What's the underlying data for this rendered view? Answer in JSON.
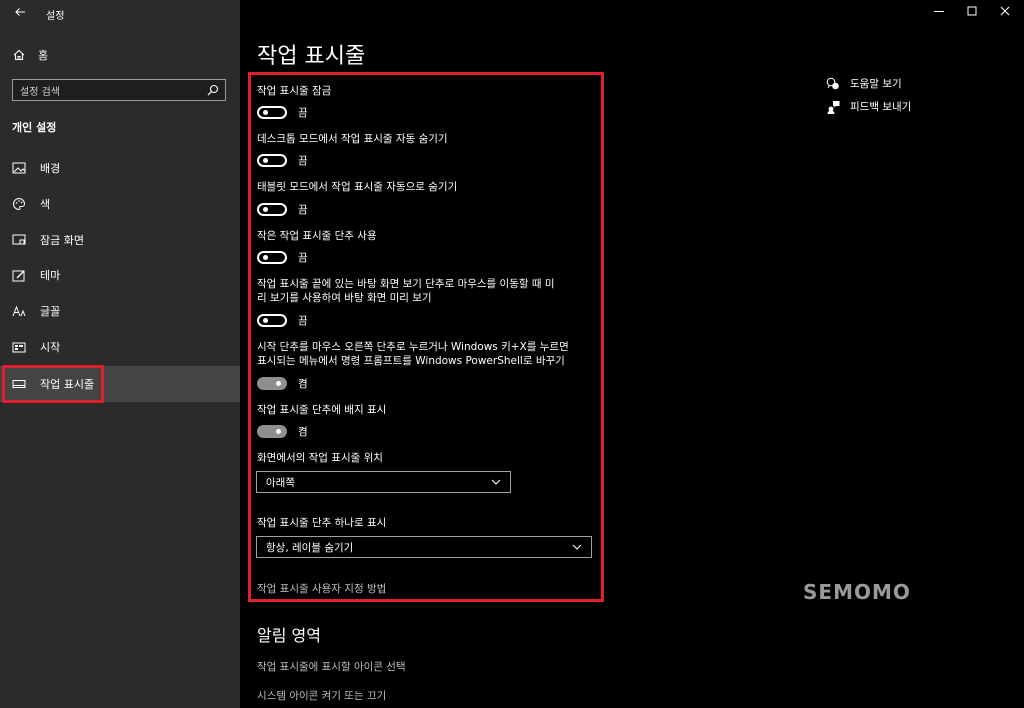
{
  "app": {
    "title": "설정"
  },
  "sidebar": {
    "home_label": "홈",
    "search_placeholder": "설정 검색",
    "section_title": "개인 설정",
    "items": [
      {
        "label": "배경",
        "icon": "picture-icon"
      },
      {
        "label": "색",
        "icon": "palette-icon"
      },
      {
        "label": "잠금 화면",
        "icon": "lock-screen-icon"
      },
      {
        "label": "테마",
        "icon": "theme-icon"
      },
      {
        "label": "글꼴",
        "icon": "font-icon"
      },
      {
        "label": "시작",
        "icon": "start-icon"
      },
      {
        "label": "작업 표시줄",
        "icon": "taskbar-icon",
        "active": true
      }
    ]
  },
  "page": {
    "title": "작업 표시줄",
    "settings": [
      {
        "label": "작업 표시줄 잠금",
        "state": "끔",
        "on": false
      },
      {
        "label": "데스크톱 모드에서 작업 표시줄 자동 숨기기",
        "state": "끔",
        "on": false
      },
      {
        "label": "태블릿 모드에서 작업 표시줄 자동으로 숨기기",
        "state": "끔",
        "on": false
      },
      {
        "label": "작은 작업 표시줄 단추 사용",
        "state": "끔",
        "on": false
      },
      {
        "label_line1": "작업 표시줄 끝에 있는 바탕 화면 보기 단추로 마우스를 이동할 때 미",
        "label_line2": "리 보기를 사용하여 바탕 화면 미리 보기",
        "state": "끔",
        "on": false
      },
      {
        "label_line1": "시작 단추를 마우스 오른쪽 단추로 누르거나 Windows 키+X를 누르면",
        "label_line2": "표시되는 메뉴에서 명령 프롬프트를 Windows PowerShell로 바꾸기",
        "state": "켬",
        "on": true
      },
      {
        "label": "작업 표시줄 단추에 배지 표시",
        "state": "켬",
        "on": true
      }
    ],
    "position": {
      "label": "화면에서의 작업 표시줄 위치",
      "value": "아래쪽"
    },
    "combine": {
      "label": "작업 표시줄 단추 하나로 표시",
      "value": "항상, 레이블 숨기기"
    },
    "customize_link": "작업 표시줄 사용자 지정 방법",
    "notification_area": {
      "title": "알림 영역",
      "links": [
        "작업 표시줄에 표시할 아이콘 선택",
        "시스템 아이콘 켜기 또는 끄기"
      ]
    }
  },
  "help": {
    "get_help": "도움말 보기",
    "feedback": "피드백 보내기"
  },
  "watermark": "SEMOMO",
  "colors": {
    "highlight": "#e0202e",
    "toggle_on": "#8f8f8f",
    "sidebar_bg": "#2b2b2b"
  }
}
